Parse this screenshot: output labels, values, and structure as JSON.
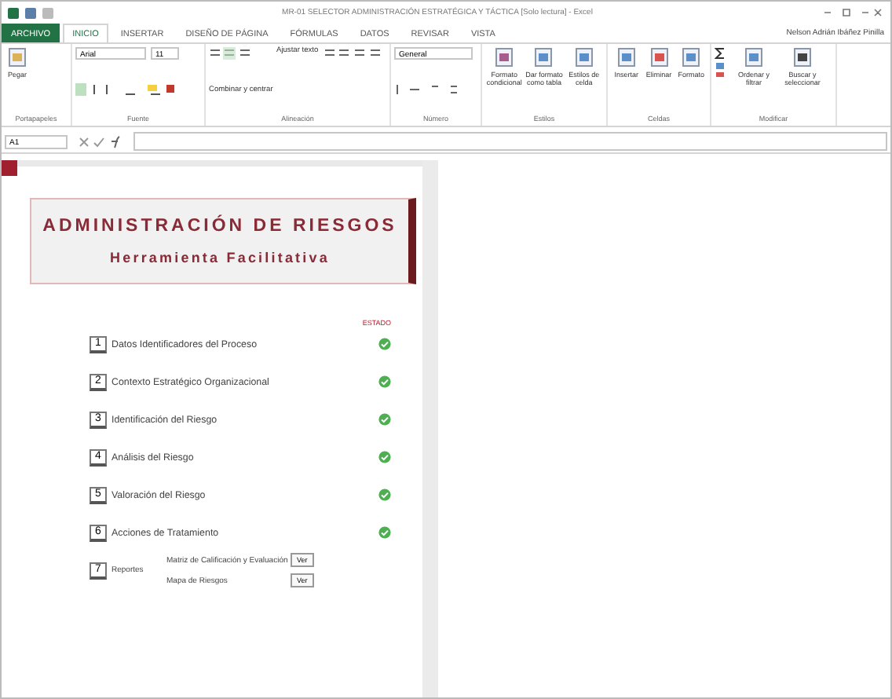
{
  "window": {
    "title": "MR-01 SELECTOR ADMINISTRACIÓN ESTRATÉGICA Y TÁCTICA [Solo lectura] - Excel",
    "account": "Nelson Adrián Ibáñez Pinilla"
  },
  "ribbon": {
    "tabs": [
      {
        "label": "ARCHIVO",
        "kind": "file",
        "selected": false
      },
      {
        "label": "INICIO",
        "kind": "tab",
        "selected": true
      },
      {
        "label": "INSERTAR",
        "kind": "tab",
        "selected": false
      },
      {
        "label": "DISEÑO DE PÁGINA",
        "kind": "tab",
        "selected": false
      },
      {
        "label": "FÓRMULAS",
        "kind": "tab",
        "selected": false
      },
      {
        "label": "DATOS",
        "kind": "tab",
        "selected": false
      },
      {
        "label": "REVISAR",
        "kind": "tab",
        "selected": false
      },
      {
        "label": "VISTA",
        "kind": "tab",
        "selected": false
      }
    ],
    "font_name": "Arial",
    "font_size": "11",
    "wrap_text": "Ajustar texto",
    "merge": "Combinar y centrar",
    "number_format": "General",
    "paste": "Pegar",
    "big_buttons": [
      {
        "label": "Formato condicional"
      },
      {
        "label": "Dar formato como tabla"
      },
      {
        "label": "Estilos de celda"
      },
      {
        "label": "Insertar"
      },
      {
        "label": "Eliminar"
      },
      {
        "label": "Formato"
      },
      {
        "label": "Ordenar y filtrar"
      },
      {
        "label": "Buscar y seleccionar"
      }
    ],
    "groups": [
      "Portapapeles",
      "Fuente",
      "Alineación",
      "Número",
      "Estilos",
      "Celdas",
      "Modificar"
    ]
  },
  "formula_bar": {
    "name_box": "A1"
  },
  "sheet": {
    "title": "ADMINISTRACIÓN DE RIESGOS",
    "subtitle": "Herramienta Facilitativa",
    "status_header": "ESTADO",
    "steps": [
      {
        "number": "1",
        "label": "Datos Identificadores del Proceso",
        "done": true
      },
      {
        "number": "2",
        "label": "Contexto Estratégico Organizacional",
        "done": true
      },
      {
        "number": "3",
        "label": "Identificación del Riesgo",
        "done": true
      },
      {
        "number": "4",
        "label": "Análisis del Riesgo",
        "done": true
      },
      {
        "number": "5",
        "label": "Valoración del Riesgo",
        "done": true
      },
      {
        "number": "6",
        "label": "Acciones de Tratamiento",
        "done": true
      }
    ],
    "reports": {
      "number": "7",
      "label": "Reportes",
      "items": [
        {
          "label": "Matriz de Calificación y Evaluación",
          "button": "Ver"
        },
        {
          "label": "Mapa de Riesgos",
          "button": "Ver"
        }
      ]
    }
  }
}
